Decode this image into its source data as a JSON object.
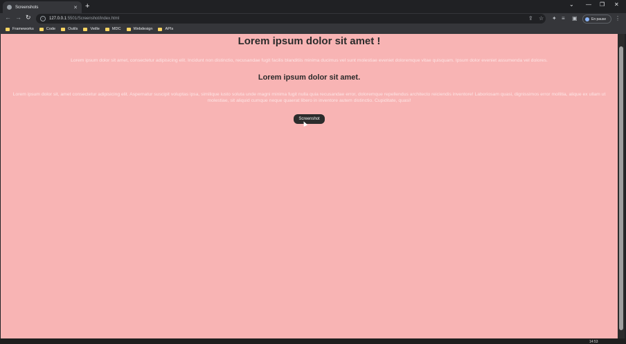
{
  "browser": {
    "tab_title": "Screenshots",
    "new_tab": "+",
    "url_host": "127.0.0.1",
    "url_rest": ":5501/Screenshot/index.html",
    "profile_status": "En pause",
    "bookmarks": [
      "Frameworks",
      "Code",
      "Outils",
      "Veille",
      "MDC",
      "Webdesign",
      "APIs"
    ]
  },
  "page": {
    "heading": "Lorem ipsum dolor sit amet !",
    "paragraph1": "Lorem ipsum dolor sit amet, consectetur adipisicing elit. Incidunt non distinctio, recusandae fugit facilis blanditiis minima ducimus vel sunt molestiae eveniet doloremque vitae quisquam. Ipsum dolor eveniet assumenda vel dolores.",
    "subheading": "Lorem ipsum dolor sit amet.",
    "paragraph2": "Lorem ipsum dolor sit, amet consectetur adipisicing elit. Aspernatur suscipit voluptas ipsa, similique iusto soluta unde magni minima fugit nulla quia recusandae error, doloremque repellendus architecto reiciendis inventore! Laboriosam quasi, dignissimos error mollitia, alique ex ullam ut molestiae, sit aliquid cumque neque quaerat libero in inventore autem distinctio. Cupiditate, quasi!",
    "button_label": "Screenshot"
  },
  "taskbar": {
    "time": "14:53"
  },
  "colors": {
    "page_background": "#f8b4b4",
    "heading_text": "#2b2b2b",
    "button_background": "#2c2c2c"
  }
}
